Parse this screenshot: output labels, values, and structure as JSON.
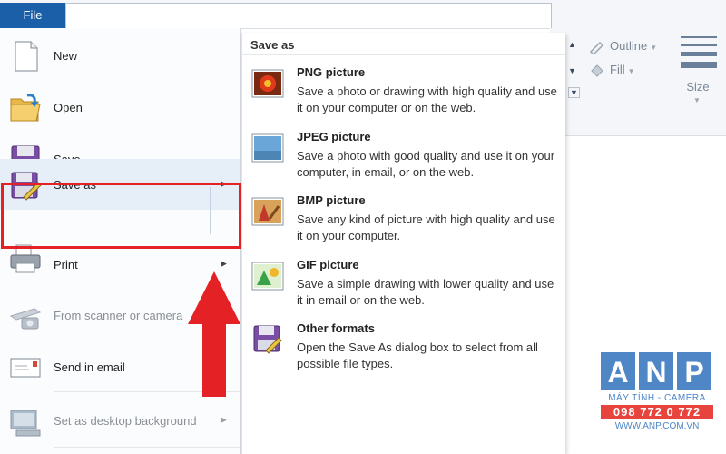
{
  "header": {
    "file_tab": "File"
  },
  "ribbon": {
    "outline_label": "Outline",
    "fill_label": "Fill",
    "size_label": "Size"
  },
  "menu": {
    "items": [
      {
        "label": "New",
        "icon": "new-file-icon",
        "enabled": true,
        "has_submenu": false
      },
      {
        "label": "Open",
        "icon": "open-folder-icon",
        "enabled": true,
        "has_submenu": false
      },
      {
        "label": "Save",
        "icon": "save-disk-icon",
        "enabled": true,
        "has_submenu": false
      },
      {
        "label": "Save as",
        "icon": "save-as-icon",
        "enabled": true,
        "has_submenu": true,
        "selected": true
      },
      {
        "label": "Print",
        "icon": "printer-icon",
        "enabled": true,
        "has_submenu": true
      },
      {
        "label": "From scanner or camera",
        "icon": "scanner-icon",
        "enabled": false,
        "has_submenu": false
      },
      {
        "label": "Send in email",
        "icon": "email-icon",
        "enabled": true,
        "has_submenu": false
      },
      {
        "label": "Set as desktop background",
        "icon": "desktop-icon",
        "enabled": false,
        "has_submenu": true
      }
    ]
  },
  "submenu": {
    "title": "Save as",
    "items": [
      {
        "title": "PNG picture",
        "desc": "Save a photo or drawing with high quality and use it on your computer or on the web.",
        "icon": "png-picture-icon"
      },
      {
        "title": "JPEG picture",
        "desc": "Save a photo with good quality and use it on your computer, in email, or on the web.",
        "icon": "jpeg-picture-icon"
      },
      {
        "title": "BMP picture",
        "desc": "Save any kind of picture with high quality and use it on your computer.",
        "icon": "bmp-picture-icon"
      },
      {
        "title": "GIF picture",
        "desc": "Save a simple drawing with lower quality and use it in email or on the web.",
        "icon": "gif-picture-icon"
      },
      {
        "title": "Other formats",
        "desc": "Open the Save As dialog box to select from all possible file types.",
        "icon": "other-formats-icon"
      }
    ]
  },
  "watermark": {
    "letters": [
      "A",
      "N",
      "P"
    ],
    "line1": "MÁY TÍNH - CAMERA",
    "phone": "098 772 0 772",
    "website": "WWW.ANP.COM.VN"
  },
  "colors": {
    "file_tab": "#1b5fa9",
    "highlight": "#e42226",
    "brand_blue": "#4f86c6"
  }
}
